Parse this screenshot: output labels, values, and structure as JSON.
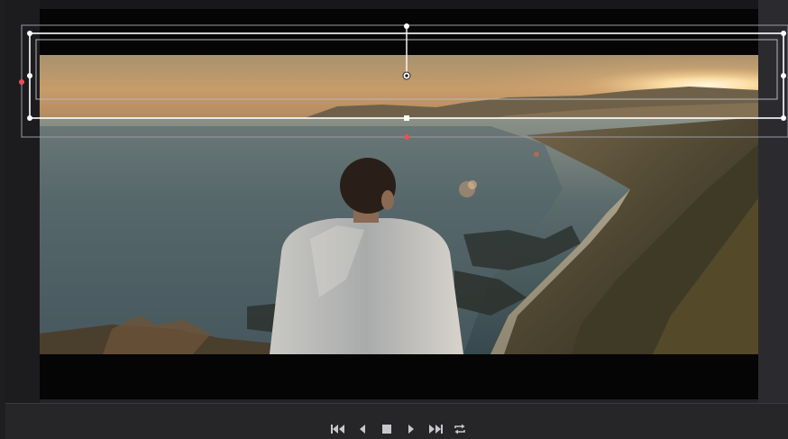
{
  "viewer": {
    "image_description_icon": "landscape-photo",
    "overlay_color": "#ffffff",
    "accent_handle_color": "#e8505b"
  },
  "transport": {
    "buttons": [
      {
        "name": "go-to-start",
        "icon": "skip-back-icon"
      },
      {
        "name": "play-reverse",
        "icon": "play-reverse-icon"
      },
      {
        "name": "stop",
        "icon": "stop-icon"
      },
      {
        "name": "play-forward",
        "icon": "play-icon"
      },
      {
        "name": "go-to-end",
        "icon": "skip-forward-icon"
      },
      {
        "name": "loop",
        "icon": "loop-icon"
      }
    ]
  }
}
